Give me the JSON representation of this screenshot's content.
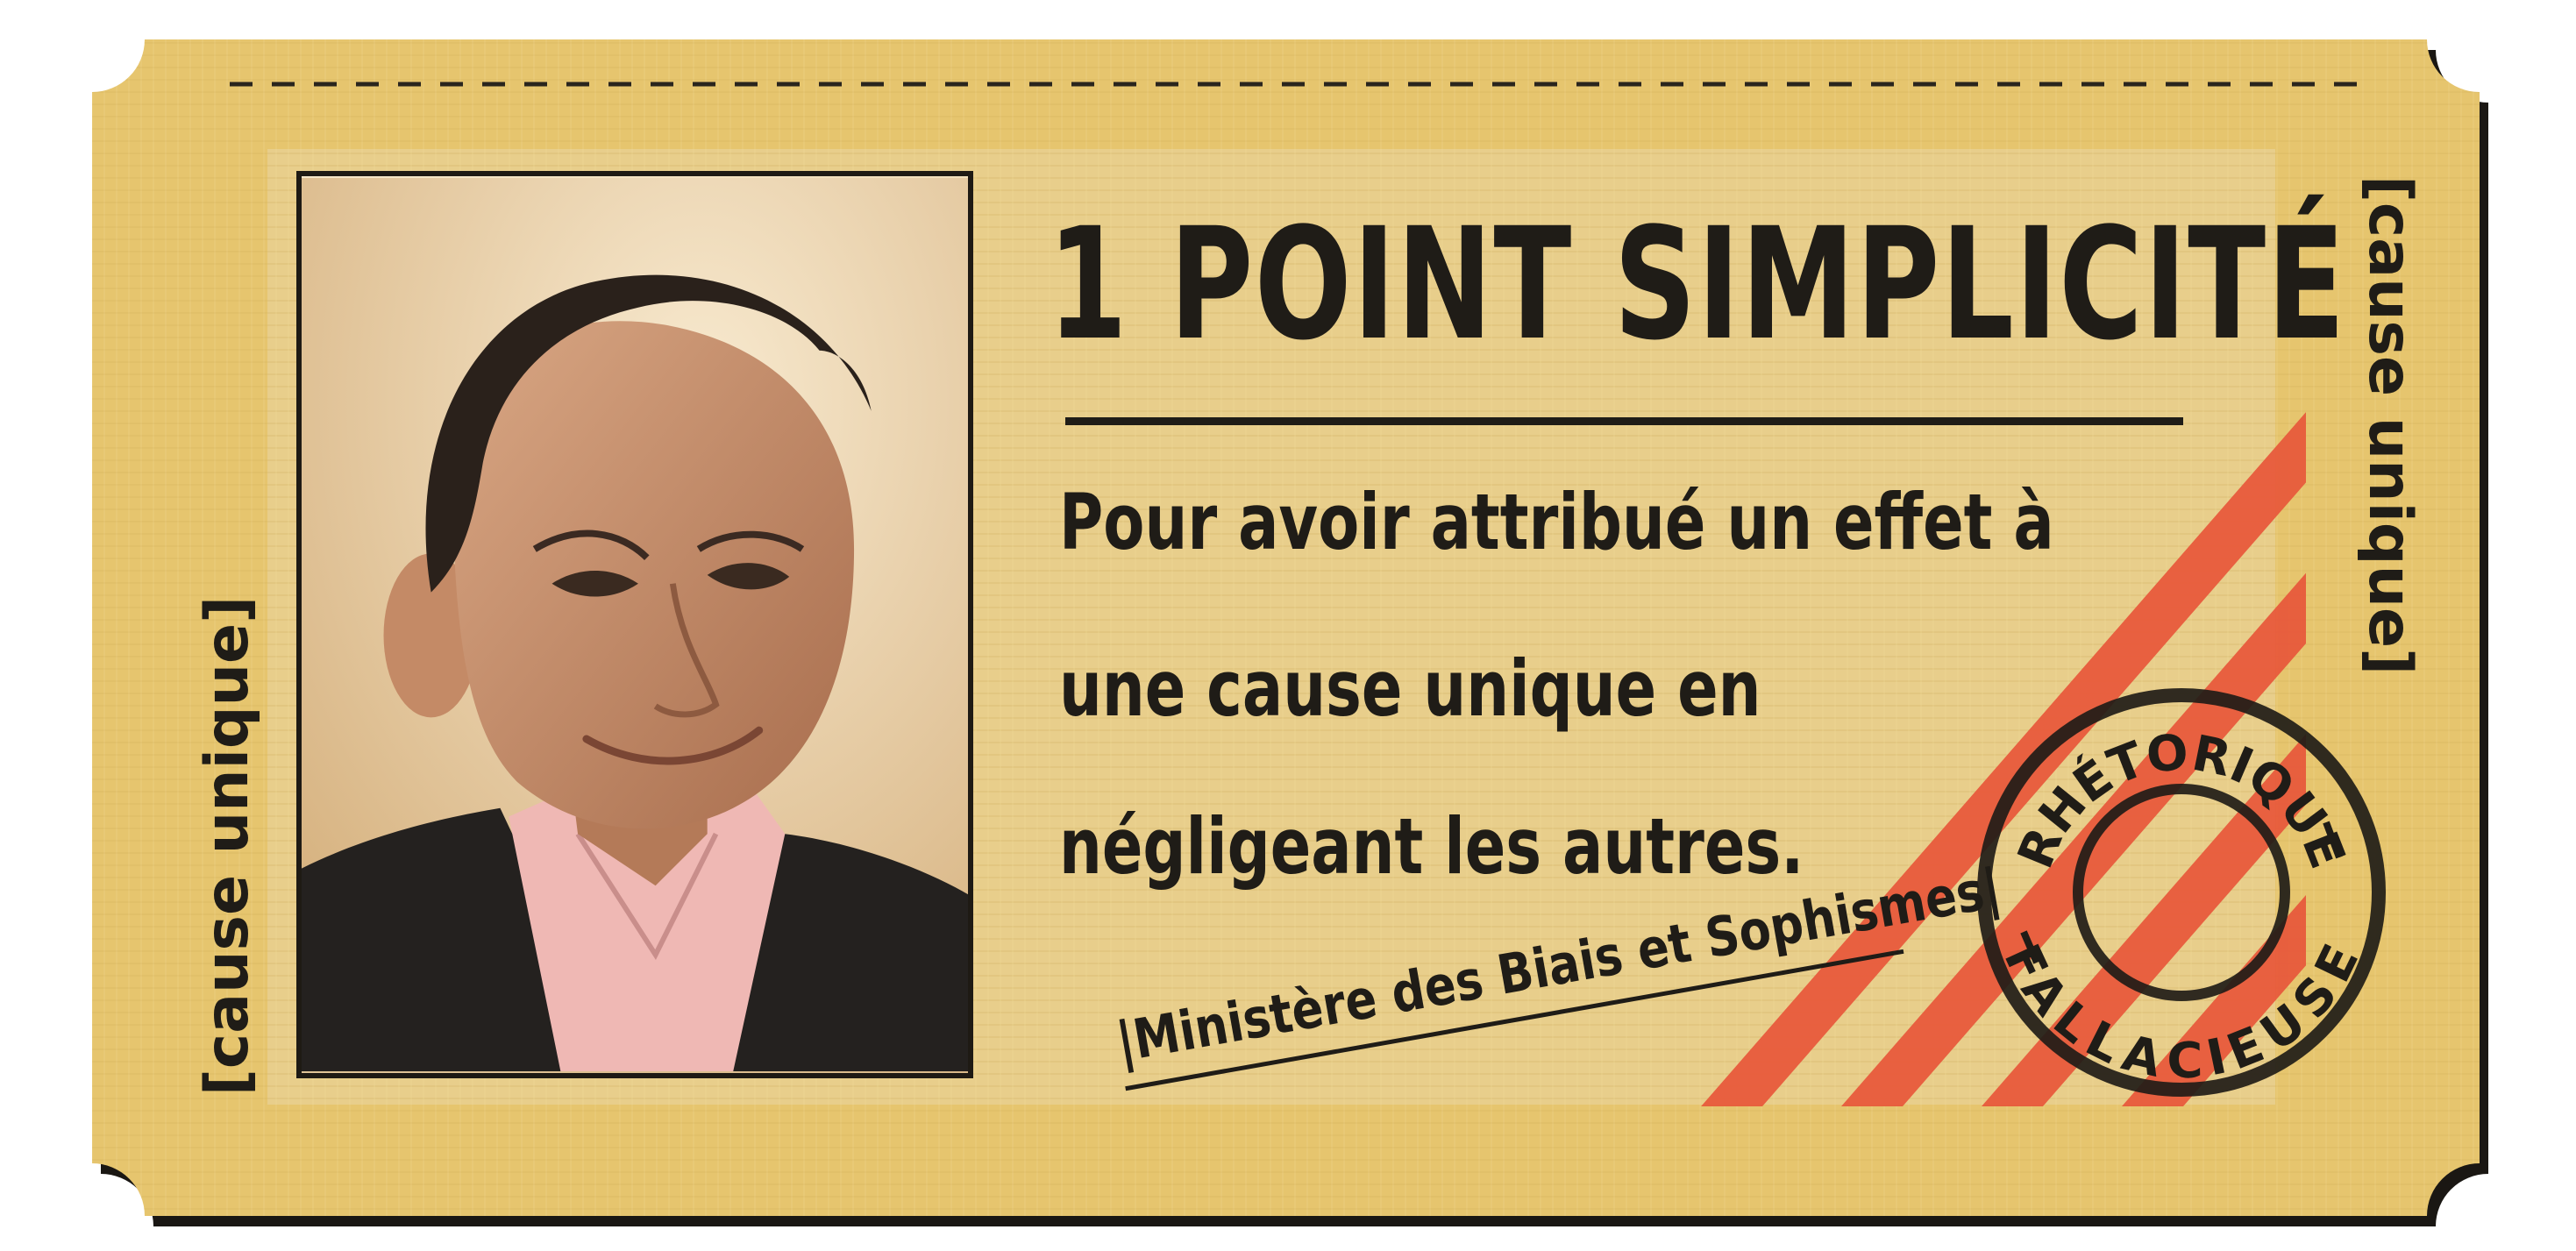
{
  "ticket": {
    "headline": "1 POINT SIMPLICITÉ",
    "body_lines": [
      "Pour avoir attribué un effet à",
      "une cause unique en",
      "négligeant les autres."
    ],
    "side_label_left": "[cause unique]",
    "side_label_right": "[cause unique]",
    "ministry": "|Ministère des Biais et Sophismes|",
    "stamp": {
      "top_text": "RHÉTORIQUE",
      "bottom_text": "FALLACIEUSE"
    },
    "colors": {
      "paper": "#e6c56e",
      "ink": "#1f1c17",
      "panel": "#e8cf91",
      "stripe": "#e8573a"
    }
  }
}
